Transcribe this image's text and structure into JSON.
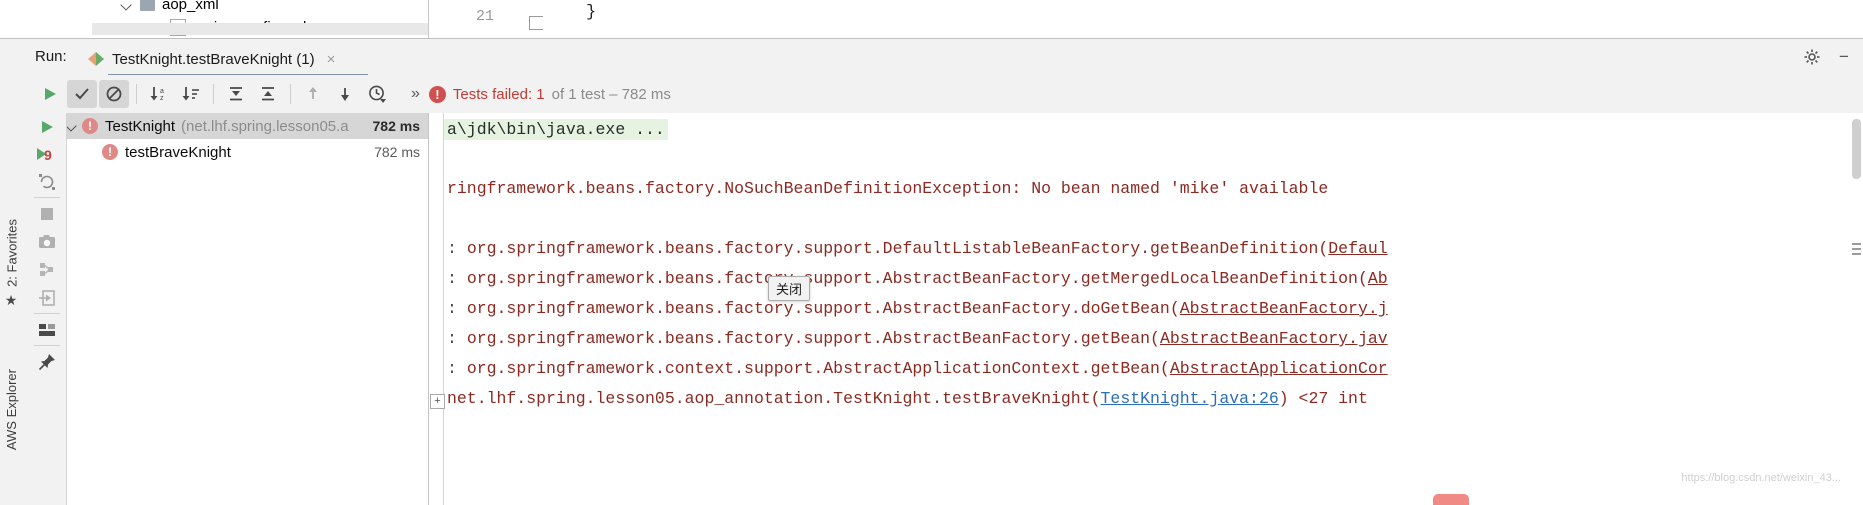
{
  "editor_strip": {
    "tree_items": [
      {
        "label": "aop_xml",
        "icon": "folder-icon"
      },
      {
        "label": "spring-config.xml",
        "icon": "xml-file-icon"
      }
    ],
    "gutter_line_number": "21",
    "code_brace": "}",
    "code_fragment": ""
  },
  "left_tool_strip": {
    "favorites_label": "2: Favorites",
    "aws_label": "AWS Explorer",
    "star_icon": "star-icon"
  },
  "run_window": {
    "run_label": "Run:",
    "tab_title": "TestKnight.testBraveKnight (1)",
    "tab_close_glyph": "×",
    "settings_icon": "gear-icon",
    "hide_icon": "minimize-icon"
  },
  "toolbar": {
    "buttons": [
      {
        "name": "rerun-tests-button",
        "icon": "play-icon",
        "pressed": false
      },
      {
        "name": "show-passed-button",
        "icon": "checkmark-icon",
        "pressed": true
      },
      {
        "name": "show-ignored-button",
        "icon": "no-entry-icon",
        "pressed": true
      },
      {
        "name": "sort-alphabetically-button",
        "icon": "sort-alpha-icon",
        "pressed": false
      },
      {
        "name": "sort-by-duration-button",
        "icon": "sort-duration-icon",
        "pressed": false
      },
      {
        "name": "expand-all-button",
        "icon": "expand-all-icon",
        "pressed": false
      },
      {
        "name": "collapse-all-button",
        "icon": "collapse-all-icon",
        "pressed": false
      },
      {
        "name": "previous-failed-button",
        "icon": "arrow-up-icon",
        "pressed": false
      },
      {
        "name": "next-failed-button",
        "icon": "arrow-down-icon",
        "pressed": false
      },
      {
        "name": "test-history-button",
        "icon": "clock-history-icon",
        "pressed": false
      }
    ],
    "overflow_glyph": "»",
    "status": {
      "error_icon": "error-badge-icon",
      "failed_text": "Tests failed: 1",
      "rest_text": " of 1 test – 782 ms"
    }
  },
  "run_gutter": {
    "icons": [
      {
        "name": "rerun-icon",
        "glyph": "play"
      },
      {
        "name": "rerun-failed-icon",
        "glyph": "play-9"
      },
      {
        "name": "rerun-automatically-icon",
        "glyph": "loop"
      },
      {
        "name": "stop-icon",
        "glyph": "square"
      },
      {
        "name": "screenshot-icon",
        "glyph": "camera"
      },
      {
        "name": "dump-threads-icon",
        "glyph": "threads"
      },
      {
        "name": "export-icon",
        "glyph": "export"
      },
      {
        "name": "layout-icon",
        "glyph": "layout"
      },
      {
        "name": "pin-tab-icon",
        "glyph": "pin"
      }
    ],
    "rerun_failed_count": "9"
  },
  "test_tree": {
    "rows": [
      {
        "name": "TestKnight",
        "package": "(net.lhf.spring.lesson05.a",
        "duration": "782 ms",
        "selected": true,
        "expandable": true,
        "indent": 0,
        "status_icon": "test-failed-icon"
      },
      {
        "name": "testBraveKnight",
        "package": "",
        "duration": "782 ms",
        "selected": false,
        "expandable": false,
        "indent": 1,
        "status_icon": "test-failed-icon"
      }
    ]
  },
  "console": {
    "lines": [
      {
        "type": "command",
        "text": "a\\jdk\\bin\\java.exe ..."
      },
      {
        "type": "exception",
        "text": "ringframework.beans.factory.NoSuchBeanDefinitionException: No bean named 'mike' available"
      },
      {
        "type": "stack",
        "prefix": ": ",
        "text": "org.springframework.beans.factory.support.DefaultListableBeanFactory.getBeanDefinition(",
        "link": "Defaul"
      },
      {
        "type": "stack",
        "prefix": ": ",
        "text": "org.springframework.beans.factory.support.AbstractBeanFactory.getMergedLocalBeanDefinition(",
        "link": "Ab"
      },
      {
        "type": "stack",
        "prefix": ": ",
        "text": "org.springframework.beans.factory.support.AbstractBeanFactory.doGetBean(",
        "link": "AbstractBeanFactory.j"
      },
      {
        "type": "stack",
        "prefix": ": ",
        "text": "org.springframework.beans.factory.support.AbstractBeanFactory.getBean(",
        "link": "AbstractBeanFactory.jav"
      },
      {
        "type": "stack",
        "prefix": ": ",
        "text": "org.springframework.context.support.AbstractApplicationContext.getBean(",
        "link": "AbstractApplicationCor"
      },
      {
        "type": "stack-fold",
        "prefix": "",
        "fold_glyph": "+",
        "text": "net.lhf.spring.lesson05.aop_annotation.TestKnight.testBraveKnight(",
        "link": "TestKnight.java:26",
        "suffix": ") <27 int"
      }
    ],
    "tooltip": "关闭",
    "watermark": "https://blog.csdn.net/weixin_43..."
  }
}
